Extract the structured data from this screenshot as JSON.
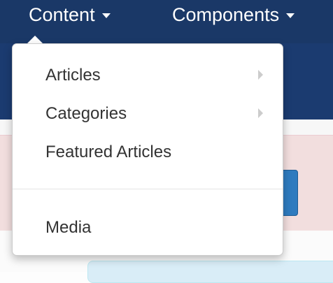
{
  "nav": {
    "content_label": "Content",
    "components_label": "Components"
  },
  "dropdown": {
    "items": [
      {
        "label": "Articles",
        "has_submenu": true
      },
      {
        "label": "Categories",
        "has_submenu": true
      },
      {
        "label": "Featured Articles",
        "has_submenu": false
      },
      {
        "label": "Media",
        "has_submenu": false
      }
    ]
  },
  "colors": {
    "navbar": "#1a3867",
    "alert_background": "#f2dede",
    "primary_button": "#2f7bbf",
    "info_background": "#d9edf7"
  },
  "icons": [
    "caret-down-icon",
    "chevron-right-icon"
  ]
}
